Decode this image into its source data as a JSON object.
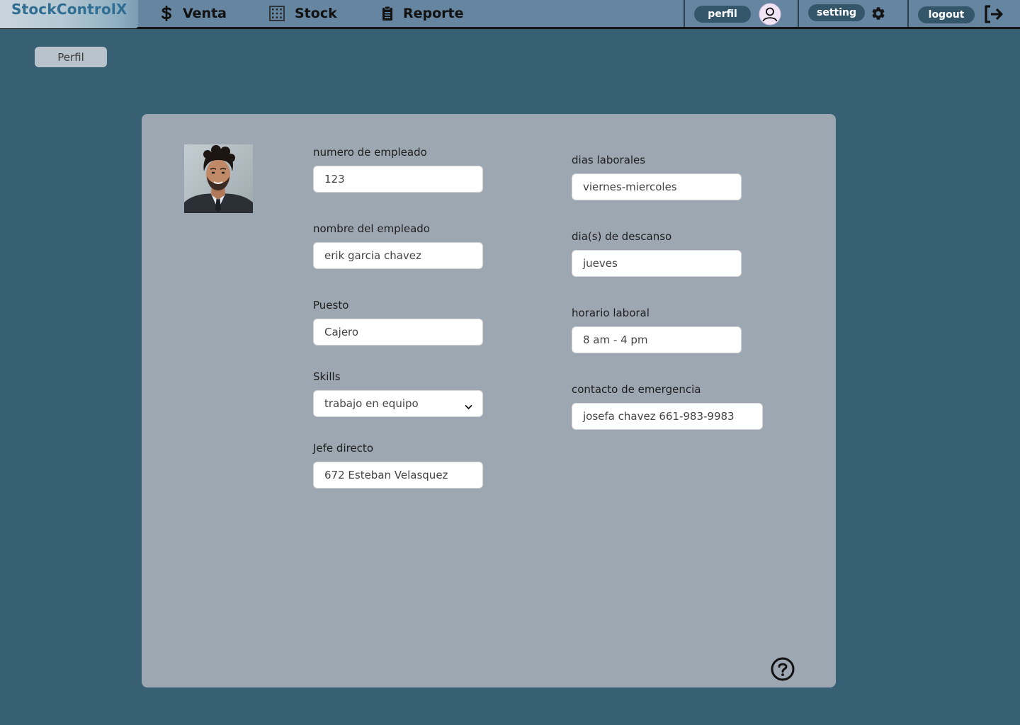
{
  "app": {
    "logo_text": "StockControlX"
  },
  "nav": {
    "items": [
      {
        "label": "Venta",
        "icon": "dollar-icon"
      },
      {
        "label": "Stock",
        "icon": "grid-icon"
      },
      {
        "label": "Reporte",
        "icon": "clipboard-icon"
      }
    ]
  },
  "header_actions": {
    "perfil_label": "perfil",
    "setting_label": "setting",
    "logout_label": "logout"
  },
  "page": {
    "tab_label": "Perfil"
  },
  "profile": {
    "photo": "employee-photo",
    "left_fields": [
      {
        "label": "numero de empleado",
        "value": "123"
      },
      {
        "label": "nombre del empleado",
        "value": "erik garcia chavez"
      },
      {
        "label": "Puesto",
        "value": "Cajero"
      },
      {
        "label": "Skills",
        "value": "trabajo en equipo"
      },
      {
        "label": "Jefe directo",
        "value": "672 Esteban Velasquez"
      }
    ],
    "right_fields": [
      {
        "label": "dias laborales",
        "value": "viernes-miercoles"
      },
      {
        "label": "dia(s) de descanso",
        "value": "jueves"
      },
      {
        "label": "horario laboral",
        "value": "8 am - 4 pm"
      },
      {
        "label": "contacto de emergencia",
        "value": "josefa chavez 661-983-9983"
      }
    ]
  },
  "colors": {
    "background": "#386075",
    "topbar": "#6585a0",
    "card": "#9da7b1",
    "pill": "#34566b",
    "logo_text": "#2f6d93"
  }
}
